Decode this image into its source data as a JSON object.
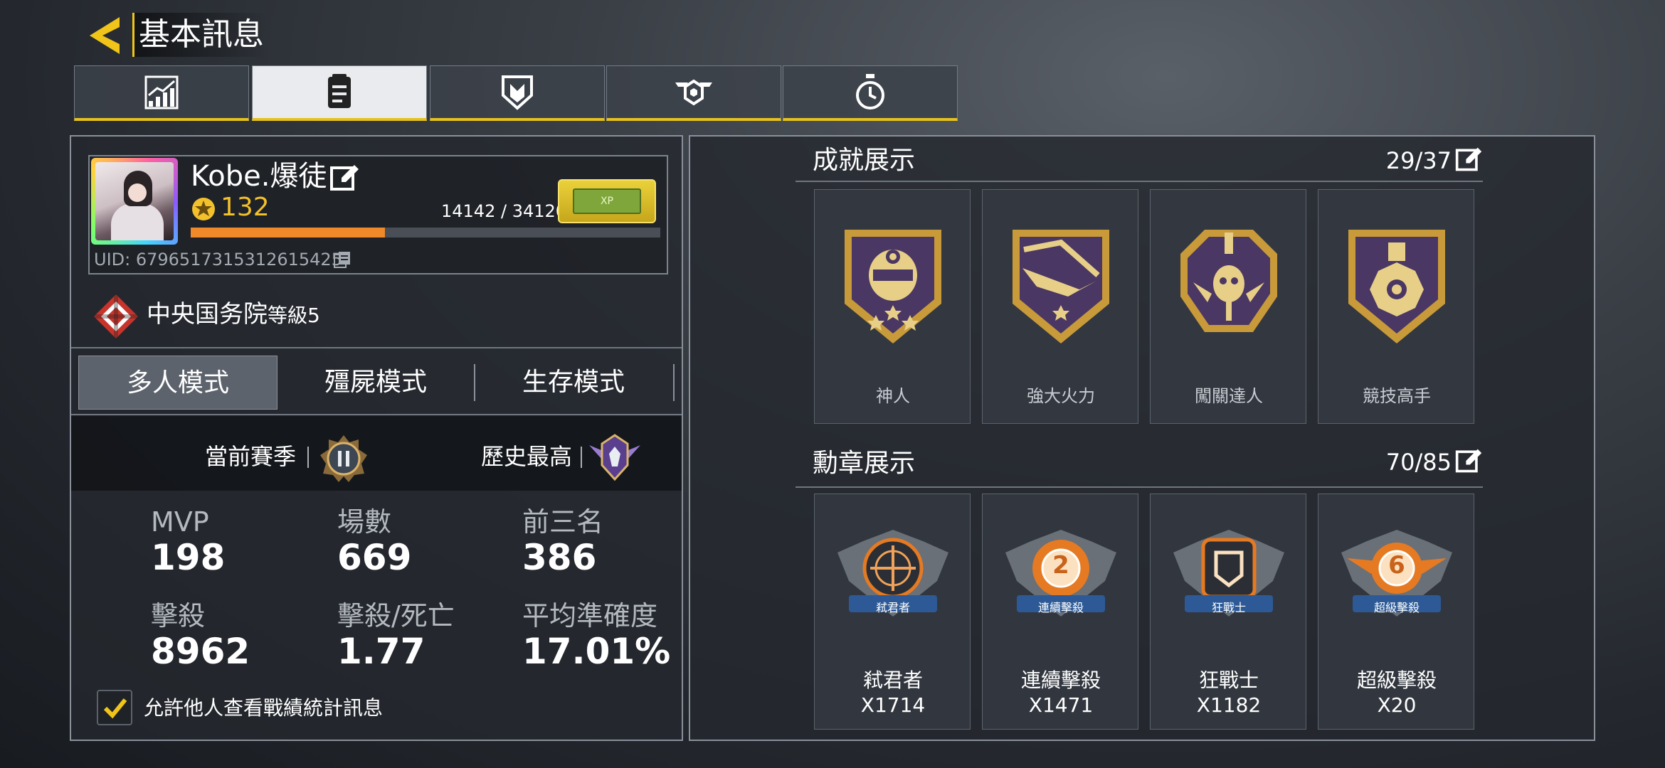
{
  "header": {
    "title": "基本訊息"
  },
  "tabs": [
    {
      "name": "stats-icon"
    },
    {
      "name": "report-icon"
    },
    {
      "name": "shield-icon"
    },
    {
      "name": "wings-badge-icon"
    },
    {
      "name": "stopwatch-icon"
    }
  ],
  "profile": {
    "name": "Kobe.爆徒",
    "level": "132",
    "xp_text": "14142 / 34120",
    "xp_progress": 0.414,
    "uid": "UID: 6796517315312615425",
    "xp_card_label": "XP"
  },
  "rank": {
    "name": "中央国务院",
    "level_text": "等級5"
  },
  "modes": [
    "多人模式",
    "殭屍模式",
    "生存模式"
  ],
  "season": {
    "current_label": "當前賽季",
    "best_label": "歷史最高"
  },
  "stats": [
    {
      "label": "MVP",
      "value": "198"
    },
    {
      "label": "場數",
      "value": "669"
    },
    {
      "label": "前三名",
      "value": "386"
    },
    {
      "label": "擊殺",
      "value": "8962"
    },
    {
      "label": "擊殺/死亡",
      "value": "1.77"
    },
    {
      "label": "平均準確度",
      "value": "17.01%"
    }
  ],
  "allow_view": {
    "label": "允許他人查看戰績統計訊息",
    "checked": true
  },
  "achievements": {
    "title": "成就展示",
    "count": "29/37",
    "items": [
      "神人",
      "強大火力",
      "闖關達人",
      "競技高手"
    ]
  },
  "medals": {
    "title": "勳章展示",
    "count": "70/85",
    "items": [
      {
        "label": "弒君者",
        "count": "X1714",
        "badge_text": "弒君者"
      },
      {
        "label": "連續擊殺",
        "count": "X1471",
        "badge_text": "連續擊殺",
        "num": "2"
      },
      {
        "label": "狂戰士",
        "count": "X1182",
        "badge_text": "狂戰士"
      },
      {
        "label": "超級擊殺",
        "count": "X20",
        "badge_text": "超級擊殺",
        "num": "6"
      }
    ]
  },
  "colors": {
    "accent": "#f0c419",
    "xp": "#f0892a",
    "level": "#f3c12b",
    "achievement_bg": "#4a3763",
    "medal_ring": "#e57a22"
  }
}
